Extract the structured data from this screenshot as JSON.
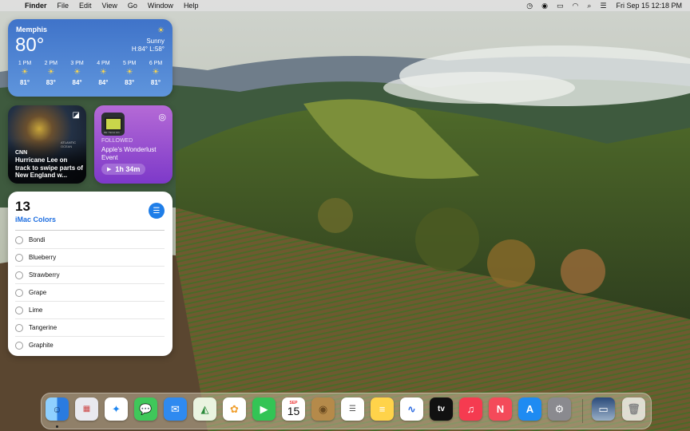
{
  "menubar": {
    "app_name": "Finder",
    "menus": [
      "File",
      "Edit",
      "View",
      "Go",
      "Window",
      "Help"
    ],
    "clock": "Fri Sep 15  12:18 PM"
  },
  "weather": {
    "city": "Memphis",
    "temp": "80°",
    "condition": "Sunny",
    "hilo": "H:84° L:58°",
    "hours": [
      {
        "time": "1 PM",
        "temp": "81°"
      },
      {
        "time": "2 PM",
        "temp": "83°"
      },
      {
        "time": "3 PM",
        "temp": "84°"
      },
      {
        "time": "4 PM",
        "temp": "84°"
      },
      {
        "time": "5 PM",
        "temp": "83°"
      },
      {
        "time": "6 PM",
        "temp": "81°"
      }
    ]
  },
  "news": {
    "source": "CNN",
    "headline": "Hurricane Lee on track to swipe parts of New England w...",
    "map_label": "ATLANTIC OCEAN"
  },
  "podcast": {
    "status": "FOLLOWED",
    "title": "Apple's Wonderlust Event",
    "duration": "1h 34m",
    "art_tag": "RE: TECH 101"
  },
  "reminders": {
    "count": "13",
    "list_name": "iMac Colors",
    "items": [
      "Bondi",
      "Blueberry",
      "Strawberry",
      "Grape",
      "Lime",
      "Tangerine",
      "Graphite"
    ]
  },
  "dock": {
    "calendar_month": "SEP",
    "calendar_day": "15",
    "tv_label": "tv",
    "colors": {
      "finder": "#3a8ee8",
      "messages": "#3fc75a",
      "mail": "#2f8af0",
      "facetime": "#33c455",
      "appstore": "#1e8bf2",
      "music": "#f53b50",
      "news": "#f44a5a"
    }
  }
}
